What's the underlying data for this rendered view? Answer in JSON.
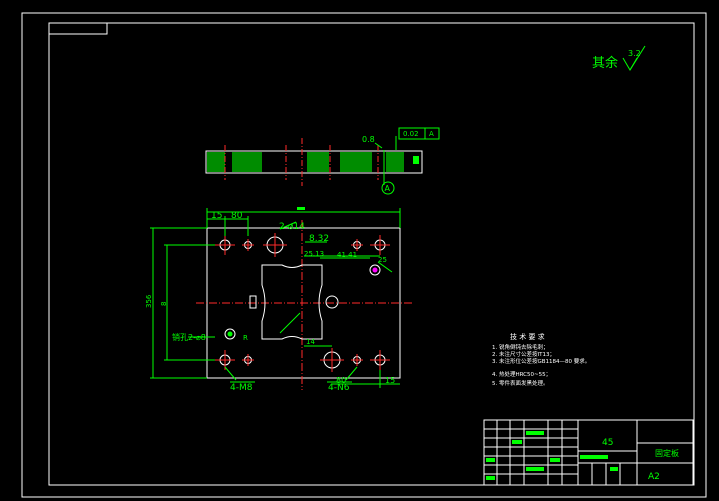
{
  "roughness": {
    "label": "其余",
    "value": "3.2"
  },
  "datum_label": "A",
  "feature_frame": {
    "value": "0.02",
    "datum": "A"
  },
  "flatness": "0.8",
  "dims": {
    "d15_left": "15",
    "d80_left": "80",
    "holes_top": "2-⌀14",
    "d832": "8.32",
    "d2513": "25.13",
    "d4141": "41.41",
    "d25": "25",
    "height_total": "356",
    "height_inner": "8",
    "pin_holes": "销孔2-⌀8",
    "r_label": "R",
    "d14_bottom": "14",
    "screws_m8": "4-M8",
    "screws_m6": "4-N6",
    "d80_right": "80",
    "d15_right": "15"
  },
  "notes": {
    "title": "技 术 要 求",
    "items": [
      "1. 锐角倒钝去除毛刺；",
      "2. 未注尺寸公差按IT13；",
      "3. 未注形位公差按GB1184—80 要求。",
      "4. 热处理HRC50~55；",
      "5. 零件表面发黑处理。"
    ]
  },
  "title_block": {
    "material": "45",
    "part_name": "固定板",
    "sheet": "A2"
  },
  "colors": {
    "line": "#ffffff",
    "green": "#00ff00",
    "red": "#ff2a2a",
    "magenta": "#ff00ff",
    "yellow": "#ffff00",
    "cyan": "#00ffff"
  }
}
